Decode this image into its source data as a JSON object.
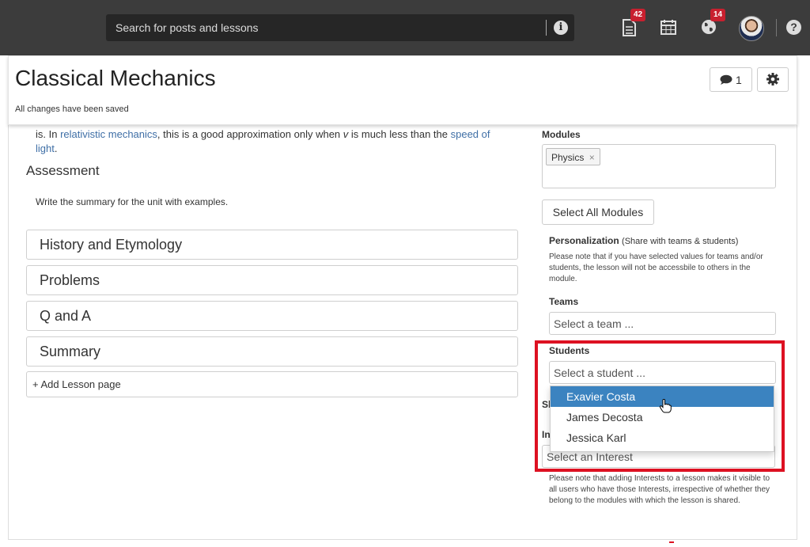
{
  "topnav": {
    "search_placeholder": "Search for posts and lessons",
    "info_glyph": "i",
    "help_glyph": "?",
    "notifications_count": "42",
    "globe_count": "14",
    "icons": [
      "info-icon",
      "document-icon",
      "calendar-icon",
      "globe-icon",
      "avatar",
      "help-icon"
    ]
  },
  "header": {
    "title": "Classical Mechanics",
    "save_status": "All changes have been saved",
    "comments_count": "1"
  },
  "content": {
    "para_prefix": "is. In ",
    "para_link1": "relativistic mechanics",
    "para_mid": ", this is a good approximation only when ",
    "para_var": "v",
    "para_mid2": " is much less than the ",
    "para_link2": "speed of light",
    "para_end": ".",
    "assessment_title": "Assessment",
    "assessment_text": "Write the summary for the unit with examples.",
    "lesson_pages": [
      "History and Etymology",
      "Problems",
      "Q and A",
      "Summary"
    ],
    "add_page_label": "+ Add Lesson page"
  },
  "sidebar": {
    "modules_label": "Modules",
    "module_tag": "Physics",
    "module_tag_remove": "×",
    "select_all_label": "Select All Modules",
    "personalization_label": "Personalization",
    "personalization_hint": "(Share with teams & students)",
    "personalization_note": "Please note that if you have selected values for teams and/or students, the lesson will not be accessbile to others in the module.",
    "teams_label": "Teams",
    "teams_placeholder": "Select a team ...",
    "students_label": "Students",
    "students_placeholder": "Select a student ...",
    "student_options": [
      "Exavier Costa",
      "James Decosta",
      "Jessica Karl"
    ],
    "share_label_partial": "Sh",
    "interests_label_partial": "In",
    "interest_placeholder": "Select an Interest",
    "interests_note": "Please note that adding Interests to a lesson makes it visible to all users who have those Interests, irrespective of whether they belong to the modules with which the lesson is shared."
  },
  "colors": {
    "nav_bg": "#3c3c3c",
    "badge": "#c8202f",
    "link": "#3f6fa6",
    "highlight": "#dd1122",
    "dropdown_active": "#3b83c0"
  }
}
